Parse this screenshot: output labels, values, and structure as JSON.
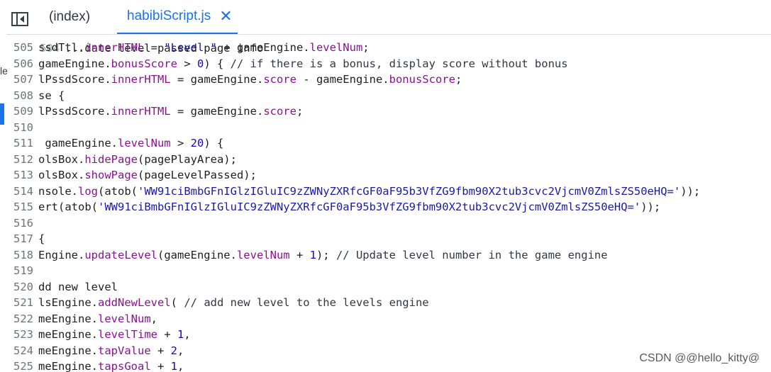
{
  "tabs": [
    {
      "label": "(index)"
    },
    {
      "label": "habibiScript.js",
      "close": "✕"
    }
  ],
  "left_fragment": "le",
  "top_partial_text": "...date level passed page info",
  "lines": [
    {
      "num": "505",
      "code": "ssdTtl.innerHTML = \"Level \" + gameEngine.levelNum;"
    },
    {
      "num": "506",
      "code": "gameEngine.bonusScore > 0) { // if there is a bonus, display score without bonus"
    },
    {
      "num": "507",
      "code": "lPssdScore.innerHTML = gameEngine.score - gameEngine.bonusScore;"
    },
    {
      "num": "508",
      "code": "se {"
    },
    {
      "num": "509",
      "code": "lPssdScore.innerHTML = gameEngine.score;"
    },
    {
      "num": "510",
      "code": ""
    },
    {
      "num": "511",
      "code": " gameEngine.levelNum > 20) {"
    },
    {
      "num": "512",
      "code": "olsBox.hidePage(pagePlayArea);"
    },
    {
      "num": "513",
      "code": "olsBox.showPage(pageLevelPassed);"
    },
    {
      "num": "514",
      "code": "nsole.log(atob('WW91ciBmbGFnIGlzIGluIC9zZWNyZXRfcGF0aF95b3VfZG9fbm90X2tub3cvc2VjcmV0ZmlsZS50eHQ='));"
    },
    {
      "num": "515",
      "code": "ert(atob('WW91ciBmbGFnIGlzIGluIC9zZWNyZXRfcGF0aF95b3VfZG9fbm90X2tub3cvc2VjcmV0ZmlsZS50eHQ='));"
    },
    {
      "num": "516",
      "code": ""
    },
    {
      "num": "517",
      "code": "{"
    },
    {
      "num": "518",
      "code": "Engine.updateLevel(gameEngine.levelNum + 1); // Update level number in the game engine"
    },
    {
      "num": "519",
      "code": ""
    },
    {
      "num": "520",
      "code": "dd new level"
    },
    {
      "num": "521",
      "code": "lsEngine.addNewLevel( // add new level to the levels engine"
    },
    {
      "num": "522",
      "code": "meEngine.levelNum,"
    },
    {
      "num": "523",
      "code": "meEngine.levelTime + 1,"
    },
    {
      "num": "524",
      "code": "meEngine.tapValue + 2,"
    },
    {
      "num": "525",
      "code": "meEngine.tapsGoal + 1,"
    }
  ],
  "watermark": "CSDN @@hello_kitty@"
}
